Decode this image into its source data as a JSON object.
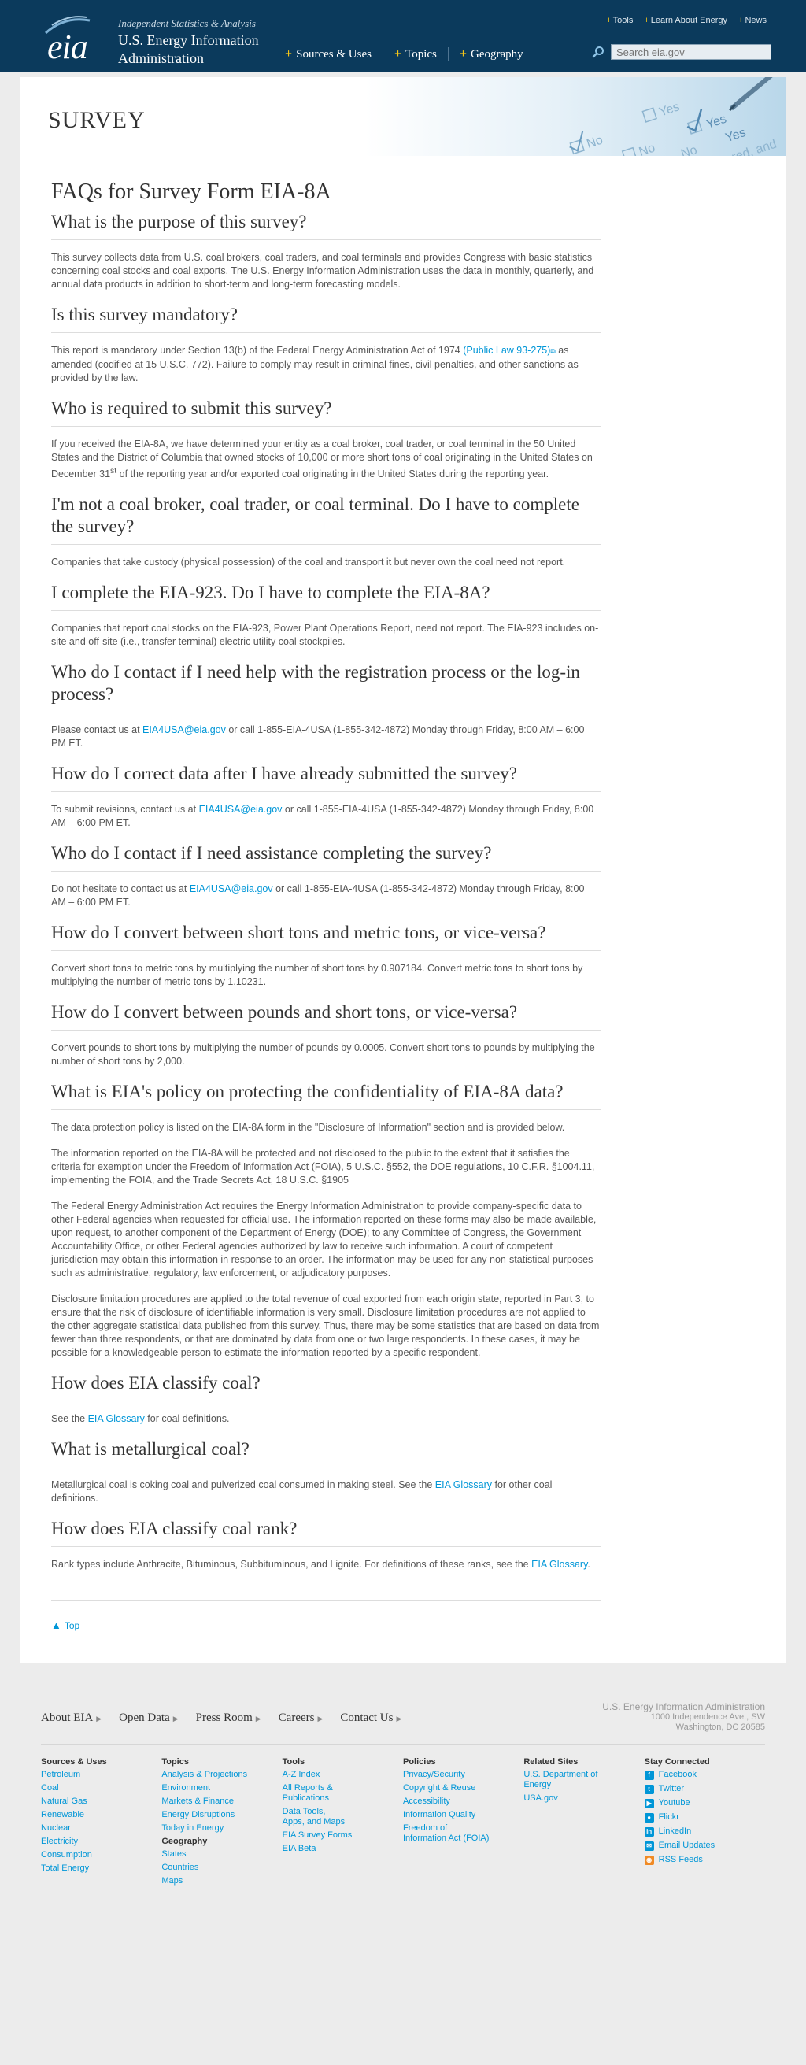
{
  "header": {
    "logo_word": "eia",
    "tagline": "Independent Statistics & Analysis",
    "agency_line1": "U.S. Energy Information",
    "agency_line2": "Administration",
    "util_nav": [
      "Tools",
      "Learn About Energy",
      "News"
    ],
    "main_nav": [
      "Sources & Uses",
      "Topics",
      "Geography"
    ],
    "search_placeholder": "Search eia.gov"
  },
  "banner": {
    "title": "SURVEY",
    "checkbox_words": [
      "No",
      "Yes",
      "No",
      "Yes",
      "No",
      "Yes",
      "red, and"
    ]
  },
  "page_title": "FAQs for Survey Form EIA-8A",
  "faqs": [
    {
      "q": "What is the purpose of this survey?",
      "p": [
        "This survey collects data from U.S. coal brokers, coal traders, and coal terminals and provides Congress with basic statistics concerning coal stocks and coal exports. The U.S. Energy Information Administration uses the data in monthly, quarterly, and annual data products in addition to short-term and long-term forecasting models."
      ]
    },
    {
      "q": "Is this survey mandatory?",
      "p1_a": "This report is mandatory under Section 13(b) of the Federal Energy Administration Act of 1974 ",
      "p1_link": "(Public Law 93-275)",
      "p1_b": " as amended (codified at 15 U.S.C. 772). Failure to comply may result in criminal fines, civil penalties, and other sanctions as provided by the law."
    },
    {
      "q": "Who is required to submit this survey?",
      "p1_a": "If you received the EIA-8A, we have determined your entity as a coal broker, coal trader, or coal terminal in the 50 United States and the District of Columbia that owned stocks of 10,000 or more short tons of coal originating in the United States on December 31",
      "p1_sup": "st",
      "p1_b": " of the reporting year and/or exported coal originating in the United States during the reporting year."
    },
    {
      "q": "I'm not a coal broker, coal trader, or coal terminal. Do I have to complete the survey?",
      "p": [
        "Companies that take custody (physical possession) of the coal and transport it but never own the coal need not report."
      ]
    },
    {
      "q": "I complete the EIA-923. Do I have to complete the EIA-8A?",
      "p": [
        "Companies that report coal stocks on the EIA-923, Power Plant Operations Report, need not report. The EIA-923 includes on-site and off-site (i.e., transfer terminal) electric utility coal stockpiles."
      ]
    },
    {
      "q": "Who do I contact if I need help with the registration process or the log-in process?",
      "p1_a": "Please contact us at ",
      "p1_link": "EIA4USA@eia.gov",
      "p1_b": " or call 1-855-EIA-4USA (1-855-342-4872) Monday through Friday, 8:00 AM – 6:00 PM ET."
    },
    {
      "q": "How do I correct data after I have already submitted the survey?",
      "p1_a": "To submit revisions, contact us at ",
      "p1_link": "EIA4USA@eia.gov",
      "p1_b": " or call 1-855-EIA-4USA (1-855-342-4872) Monday through Friday, 8:00 AM – 6:00 PM ET."
    },
    {
      "q": "Who do I contact if I need assistance completing the survey?",
      "p1_a": "Do not hesitate to contact us at ",
      "p1_link": "EIA4USA@eia.gov",
      "p1_b": " or call 1-855-EIA-4USA (1-855-342-4872) Monday through Friday, 8:00 AM – 6:00 PM ET."
    },
    {
      "q": "How do I convert between short tons and metric tons, or vice-versa?",
      "p": [
        "Convert short tons to metric tons by multiplying the number of short tons by 0.907184. Convert metric tons to short tons by multiplying the number of metric tons by 1.10231."
      ]
    },
    {
      "q": "How do I convert between pounds and short tons, or vice-versa?",
      "p": [
        "Convert pounds to short tons by multiplying the number of pounds by 0.0005. Convert short tons to pounds by multiplying the number of short tons by 2,000."
      ]
    },
    {
      "q": "What is EIA's policy on protecting the confidentiality of EIA-8A data?",
      "p": [
        "The data protection policy is listed on the EIA-8A form in the \"Disclosure of Information\" section and is provided below.",
        "The information reported on the EIA-8A will be protected and not disclosed to the public to the extent that it satisfies the criteria for exemption under the Freedom of Information Act (FOIA), 5 U.S.C. §552, the DOE regulations, 10 C.F.R. §1004.11, implementing the FOIA, and the Trade Secrets Act, 18 U.S.C. §1905",
        "The Federal Energy Administration Act requires the Energy Information Administration to provide company-specific data to other Federal agencies when requested for official use. The information reported on these forms may also be made available, upon request, to another component of the Department of Energy (DOE); to any Committee of Congress, the Government Accountability Office, or other Federal agencies authorized by law to receive such information. A court of competent jurisdiction may obtain this information in response to an order. The information may be used for any non-statistical purposes such as administrative, regulatory, law enforcement, or adjudicatory purposes.",
        "Disclosure limitation procedures are applied to the total revenue of coal exported from each origin state, reported in Part 3, to ensure that the risk of disclosure of identifiable information is very small. Disclosure limitation procedures are not applied to the other aggregate statistical data published from this survey. Thus, there may be some statistics that are based on data from fewer than three respondents, or that are dominated by data from one or two large respondents. In these cases, it may be possible for a knowledgeable person to estimate the information reported by a specific respondent."
      ]
    },
    {
      "q": "How does EIA classify coal?",
      "p1_a": "See the ",
      "p1_link": "EIA Glossary",
      "p1_b": " for coal definitions."
    },
    {
      "q": "What is metallurgical coal?",
      "p1_a": "Metallurgical coal is coking coal and pulverized coal consumed in making steel. See the ",
      "p1_link": "EIA Glossary",
      "p1_b": " for other coal definitions."
    },
    {
      "q": "How does EIA classify coal rank?",
      "p1_a": "Rank types include Anthracite, Bituminous, Subbituminous, and Lignite. For definitions of these ranks, see the ",
      "p1_link": "EIA Glossary",
      "p1_b": "."
    }
  ],
  "top_link": "Top",
  "footer": {
    "nav": [
      "About EIA",
      "Open Data",
      "Press Room",
      "Careers",
      "Contact Us"
    ],
    "address": [
      "U.S. Energy Information Administration",
      "1000 Independence Ave., SW",
      "Washington, DC 20585"
    ],
    "columns": [
      {
        "title": "Sources & Uses",
        "links": [
          "Petroleum",
          "Coal",
          "Natural Gas",
          "Renewable",
          "Nuclear",
          "Electricity",
          "Consumption",
          "Total Energy"
        ]
      },
      {
        "title": "Topics",
        "links": [
          "Analysis & Projections",
          "Environment",
          "Markets & Finance",
          "Energy Disruptions",
          "Today in Energy"
        ],
        "sub_title": "Geography",
        "sub_links": [
          "States",
          "Countries",
          "Maps"
        ]
      },
      {
        "title": "Tools",
        "links": [
          "A-Z Index",
          "All Reports & Publications",
          "Data Tools, Apps, and Maps",
          "EIA Survey Forms",
          "EIA Beta"
        ]
      },
      {
        "title": "Policies",
        "links": [
          "Privacy/Security",
          "Copyright & Reuse",
          "Accessibility",
          "Information Quality",
          "Freedom of Information Act (FOIA)"
        ]
      },
      {
        "title": "Related Sites",
        "links": [
          "U.S. Department of Energy",
          "USA.gov"
        ]
      },
      {
        "title": "Stay Connected",
        "social": [
          "Facebook",
          "Twitter",
          "Youtube",
          "Flickr",
          "LinkedIn",
          "Email Updates",
          "RSS Feeds"
        ]
      }
    ]
  },
  "colors": {
    "header_bg": "#0b3a5c",
    "link": "#0096d7",
    "accent": "#f5c518"
  }
}
